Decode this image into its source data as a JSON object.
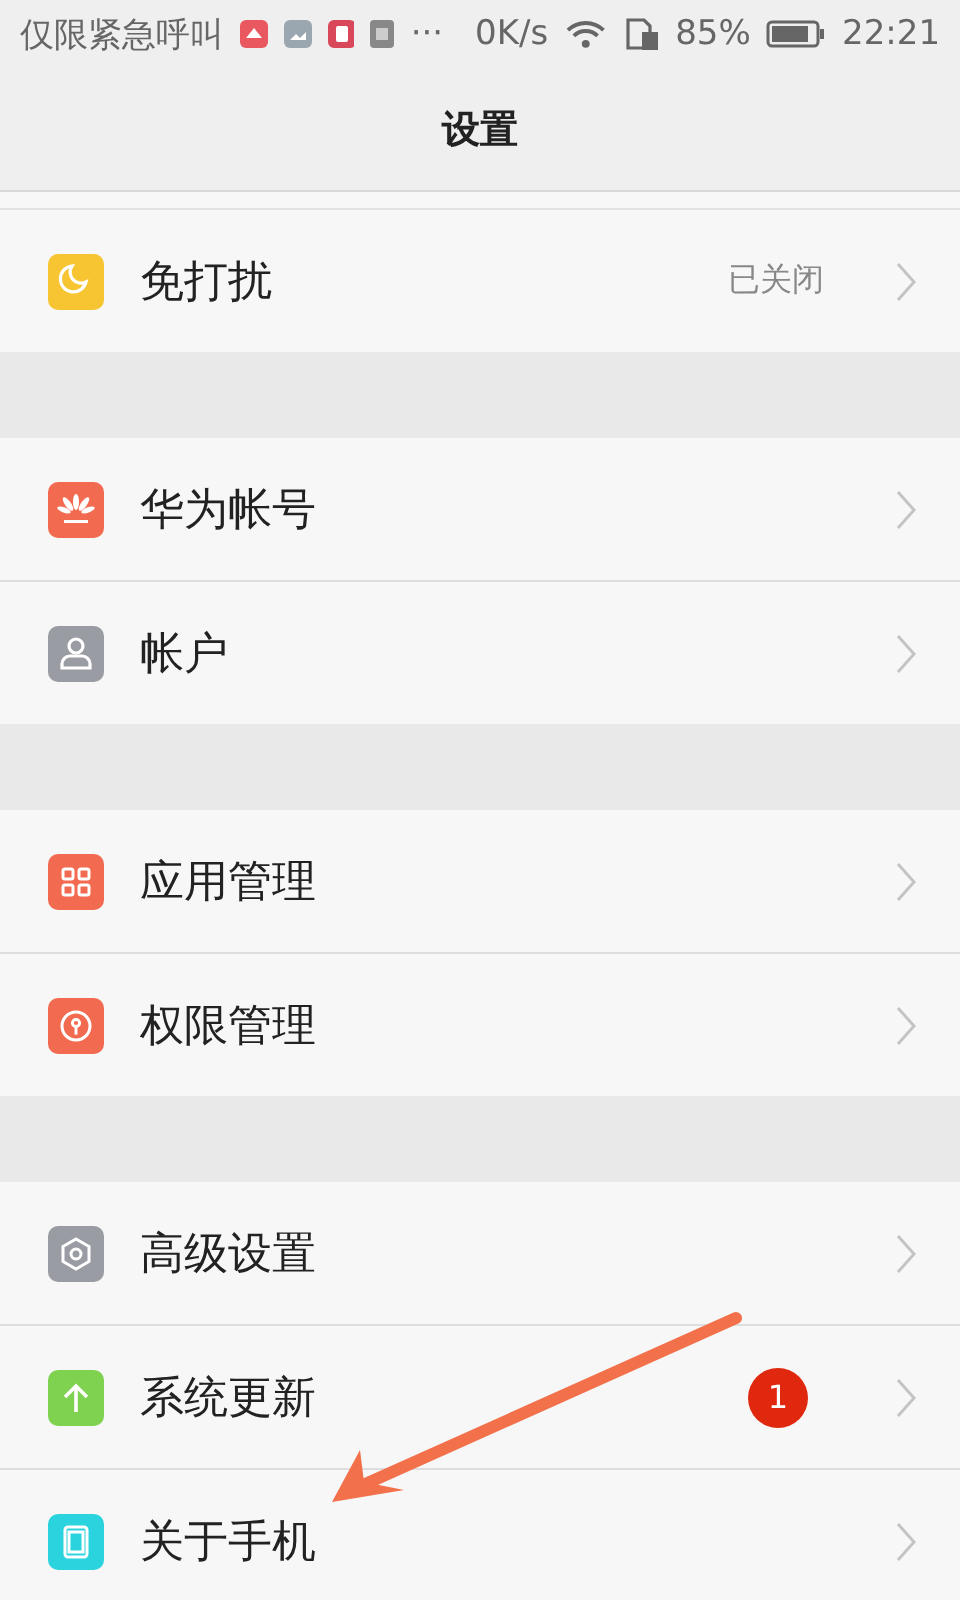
{
  "status_bar": {
    "carrier": "仅限紧急呼叫",
    "more": "···",
    "speed": "0K/s",
    "battery": "85%",
    "time": "22:21"
  },
  "title": "设置",
  "groups": [
    [
      {
        "label": "免打扰",
        "value": "已关闭"
      }
    ],
    [
      {
        "label": "华为帐号"
      },
      {
        "label": "帐户"
      }
    ],
    [
      {
        "label": "应用管理"
      },
      {
        "label": "权限管理"
      }
    ],
    [
      {
        "label": "高级设置"
      },
      {
        "label": "系统更新",
        "badge": "1"
      },
      {
        "label": "关于手机"
      }
    ]
  ],
  "annotation": {
    "kind": "arrow"
  }
}
